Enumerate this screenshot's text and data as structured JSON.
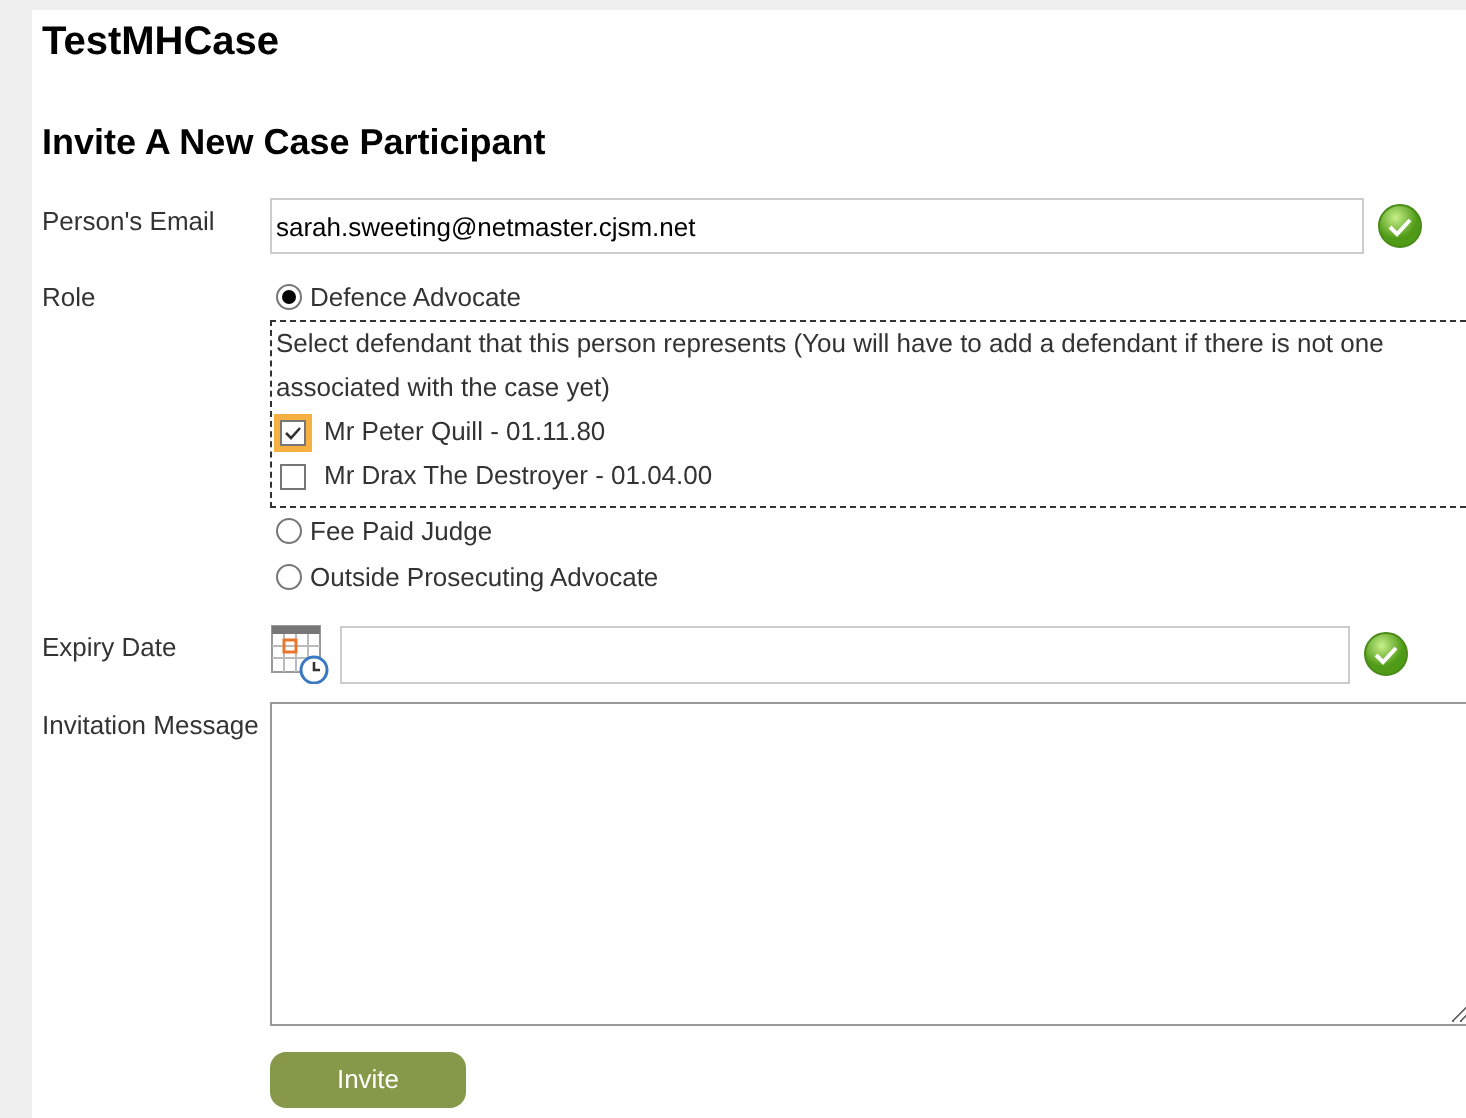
{
  "case_title": "TestMHCase",
  "heading": "Invite A New Case Participant",
  "email": {
    "label": "Person's Email",
    "value": "sarah.sweeting@netmaster.cjsm.net"
  },
  "role": {
    "label": "Role",
    "options": [
      {
        "label": "Defence Advocate",
        "selected": true,
        "defendants": {
          "note": "Select defendant that this person represents (You will have to add a defendant if there is not one associated with the case yet)",
          "items": [
            {
              "label": "Mr Peter Quill - 01.11.80",
              "checked": true,
              "focused": true
            },
            {
              "label": "Mr Drax The Destroyer - 01.04.00",
              "checked": false,
              "focused": false
            }
          ]
        }
      },
      {
        "label": "Fee Paid Judge",
        "selected": false
      },
      {
        "label": "Outside Prosecuting Advocate",
        "selected": false
      }
    ]
  },
  "expiry": {
    "label": "Expiry Date"
  },
  "message": {
    "label": "Invitation Message"
  },
  "button": "Invite"
}
